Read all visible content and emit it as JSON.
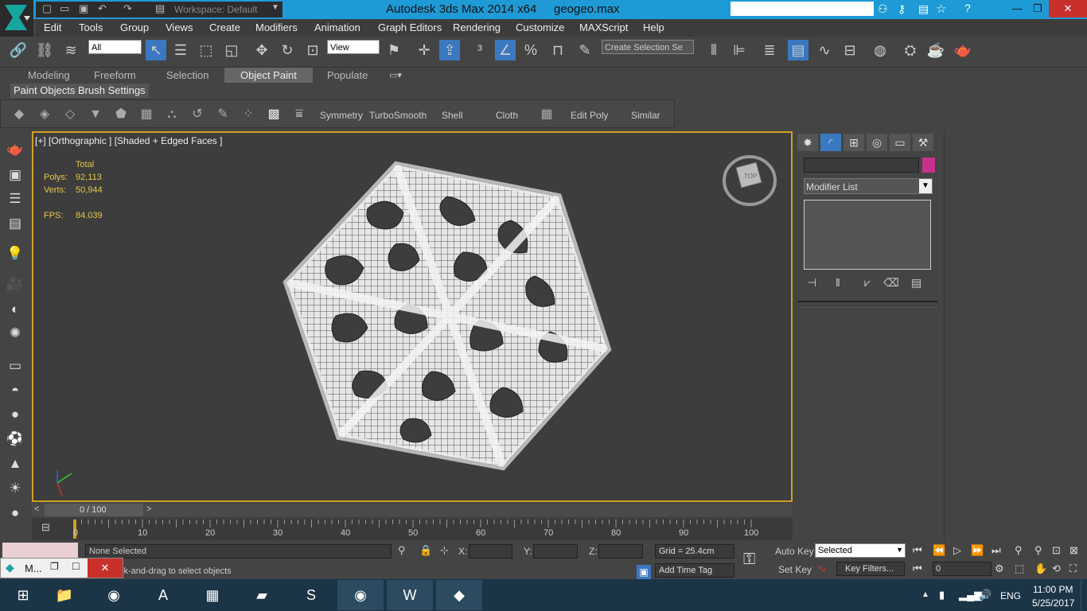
{
  "titlebar": {
    "workspace": "Workspace: Default",
    "title": "Autodesk 3ds Max  2014 x64",
    "filename": "geogeo.max"
  },
  "menu": [
    "Edit",
    "Tools",
    "Group",
    "Views",
    "Create",
    "Modifiers",
    "Animation",
    "Graph Editors",
    "Rendering",
    "Customize",
    "MAXScript",
    "Help"
  ],
  "toolbar": {
    "selection_filter": "All",
    "ref_coord": "View",
    "named_selection": "Create Selection Se"
  },
  "ribbon": {
    "tabs": [
      "Modeling",
      "Freeform",
      "Selection",
      "Object Paint",
      "Populate"
    ],
    "active_tab": "Object Paint",
    "subtabs": [
      "Paint Objects",
      "Brush Settings"
    ],
    "tools": [
      "Symmetry",
      "TurboSmooth",
      "Shell",
      "Cloth",
      "Edit Poly",
      "Similar"
    ]
  },
  "viewport": {
    "label": "[+] [Orthographic ] [Shaded + Edged Faces ]",
    "stats_header": "Total",
    "polys_label": "Polys:",
    "polys": "92,113",
    "verts_label": "Verts:",
    "verts": "50,944",
    "fps_label": "FPS:",
    "fps": "84.039",
    "viewcube_label": "TOP"
  },
  "command_panel": {
    "modifier_list": "Modifier List",
    "name_color": "#c8328c"
  },
  "timeline": {
    "frame": "0 / 100",
    "ticks": [
      "0",
      "10",
      "20",
      "30",
      "40",
      "50",
      "60",
      "70",
      "80",
      "90",
      "100"
    ]
  },
  "status": {
    "selection": "None Selected",
    "prompt": "ck-and-drag to select objects",
    "x_label": "X:",
    "y_label": "Y:",
    "z_label": "Z:",
    "grid": "Grid = 25.4cm",
    "add_time_tag": "Add Time Tag",
    "auto_key": "Auto Key",
    "set_key": "Set Key",
    "key_mode": "Selected",
    "key_filters": "Key Filters...",
    "frame_value": "0"
  },
  "minimized_window": {
    "title": "M..."
  },
  "taskbar": {
    "lang": "ENG",
    "time": "11:00 PM",
    "date": "5/25/2017"
  },
  "colors": {
    "title_bar": "#1e9bd6",
    "viewport_border": "#d0a020",
    "stat_text": "#e6c84a"
  }
}
